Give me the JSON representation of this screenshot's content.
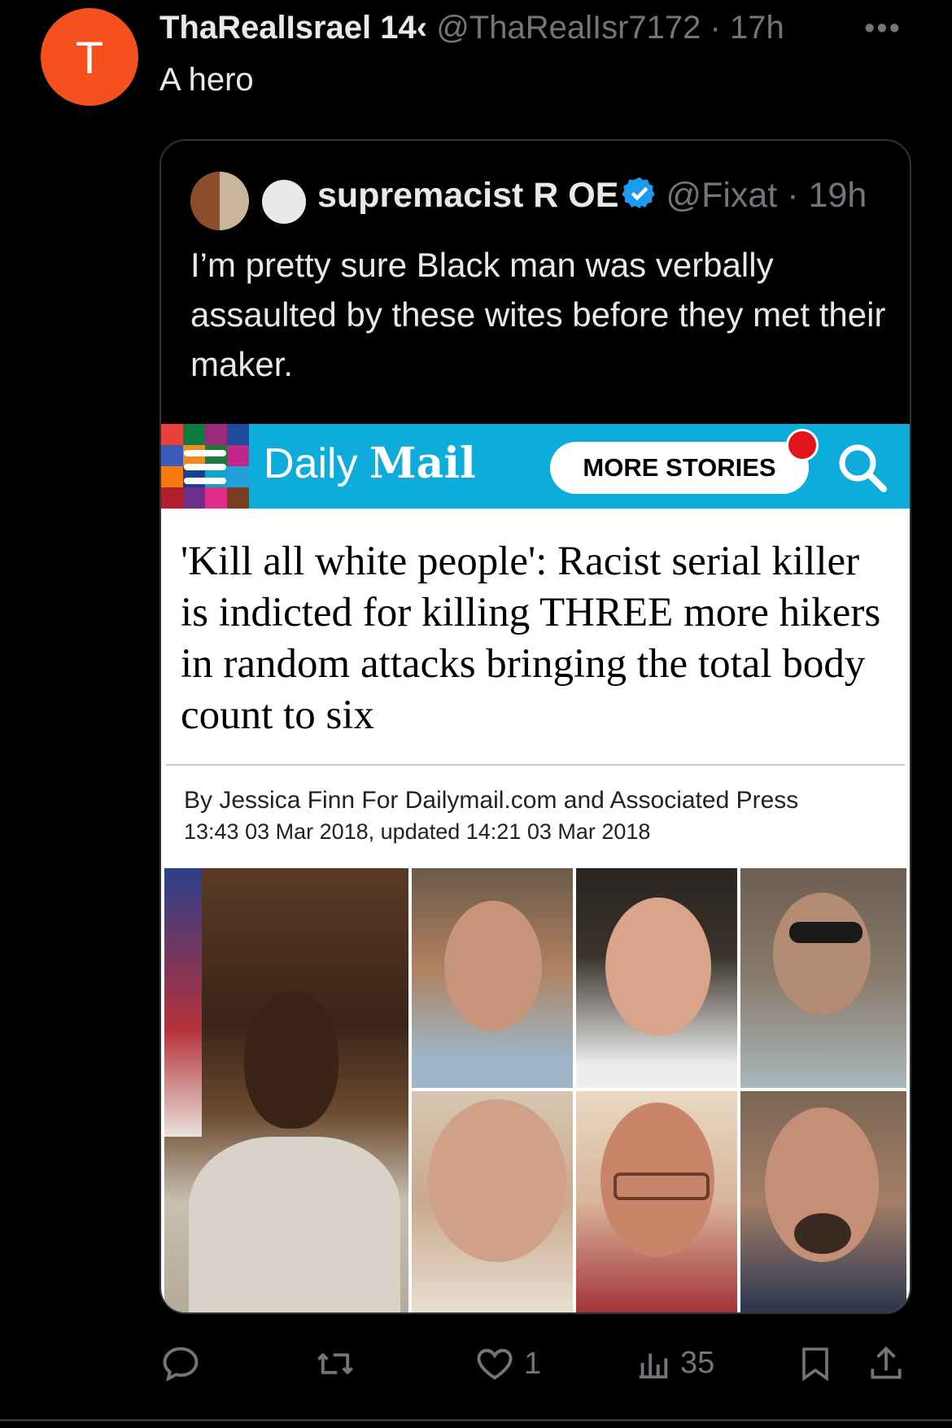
{
  "tweet": {
    "avatar_letter": "T",
    "display_name": "ThaRealIsrael 14‹",
    "handle": "@ThaRealIsr7172",
    "separator": "·",
    "time": "17h",
    "more": "•••",
    "text": "A hero"
  },
  "quote": {
    "display_name": "supremacist R OE",
    "handle": "@Fixat",
    "separator": "·",
    "time": "19h",
    "text": "I’m pretty sure Black man was verbally assaulted by these wites before they met their maker."
  },
  "article": {
    "logo_daily": "Daily",
    "logo_mail": "Mail",
    "more_stories": "MORE STORIES",
    "headline": "'Kill all white people': Racist serial killer is indicted for killing THREE more hikers in random attacks bringing the total body count to six",
    "byline": "By Jessica Finn For Dailymail.com and Associated Press",
    "dateline": "13:43 03 Mar 2018, updated 14:21 03 Mar 2018"
  },
  "actions": {
    "reply_count": "",
    "retweet_count": "",
    "like_count": "1",
    "views_count": "35"
  },
  "colors": {
    "background": "#000000",
    "avatar": "#f4511e",
    "verified": "#1d9bf0",
    "dailymail_bar": "#0dacdb",
    "muted_text": "#71767b"
  },
  "icons": [
    "more-icon",
    "verified-icon",
    "menu-icon",
    "search-icon",
    "reply-icon",
    "retweet-icon",
    "like-icon",
    "views-icon",
    "bookmark-icon",
    "share-icon"
  ]
}
